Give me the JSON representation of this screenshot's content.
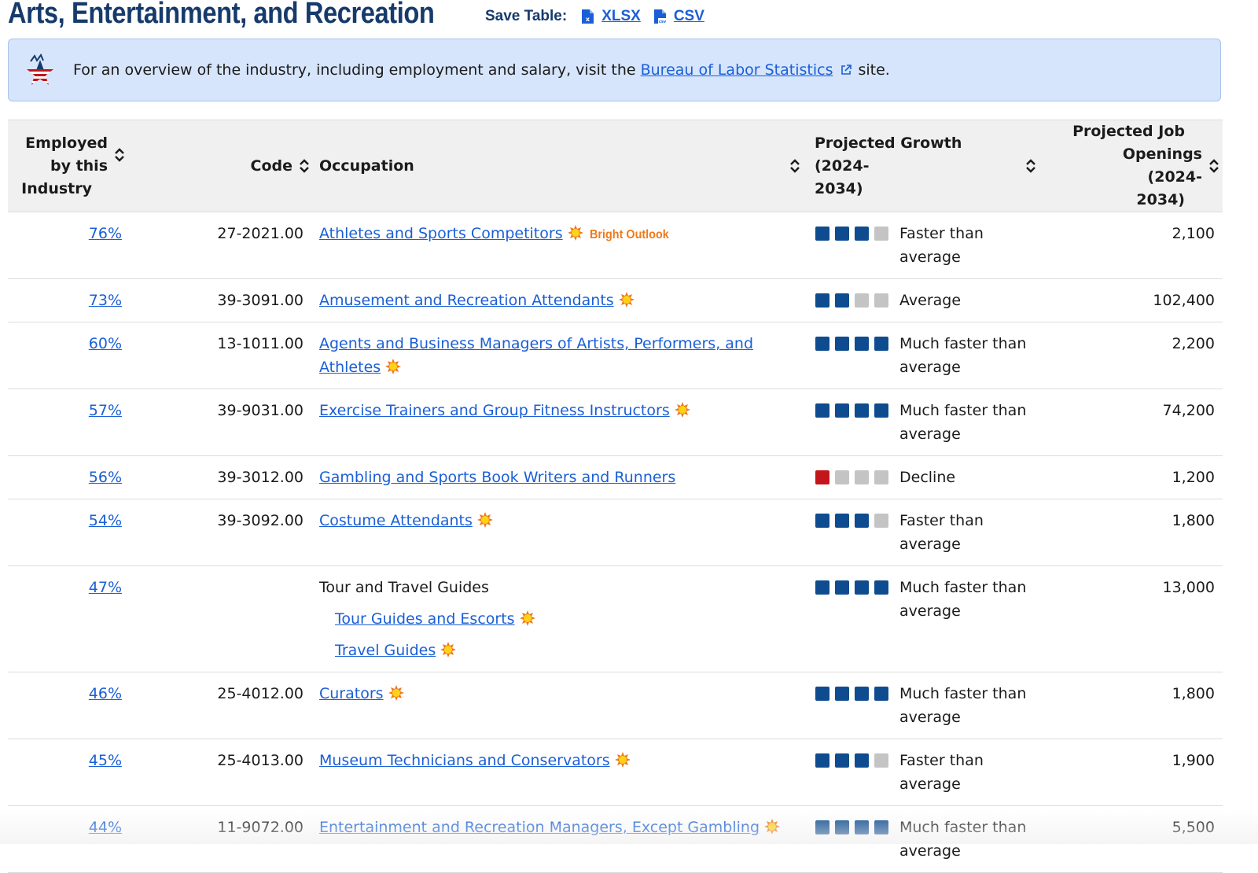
{
  "header": {
    "title": "Arts, Entertainment, and Recreation",
    "save_label": "Save Table:",
    "xlsx_label": "XLSX",
    "csv_label": "CSV"
  },
  "banner": {
    "text_before": "For an overview of the industry, including employment and salary, visit the",
    "link_text": "Bureau of Labor Statistics",
    "text_after": "site."
  },
  "table": {
    "columns": {
      "employed": [
        "Employed",
        "by this",
        "Industry"
      ],
      "code": "Code",
      "occupation": "Occupation",
      "growth": [
        "Projected Growth (2024-",
        "2034)"
      ],
      "openings": [
        "Projected Job",
        "Openings (2024-",
        "2034)"
      ]
    },
    "bright_outlook_label": "Bright Outlook",
    "rows": [
      {
        "pct": "76%",
        "code": "27-2021.00",
        "occupation": "Athletes and Sports Competitors",
        "growth_level": 3,
        "growth": "Faster than average",
        "openings": "2,100"
      },
      {
        "pct": "73%",
        "code": "39-3091.00",
        "occupation": "Amusement and Recreation Attendants",
        "growth_level": 2,
        "growth": "Average",
        "openings": "102,400"
      },
      {
        "pct": "60%",
        "code": "13-1011.00",
        "occupation": "Agents and Business Managers of Artists, Performers, and Athletes",
        "growth_level": 4,
        "growth": "Much faster than average",
        "openings": "2,200"
      },
      {
        "pct": "57%",
        "code": "39-9031.00",
        "occupation": "Exercise Trainers and Group Fitness Instructors",
        "growth_level": 4,
        "growth": "Much faster than average",
        "openings": "74,200"
      },
      {
        "pct": "56%",
        "code": "39-3012.00",
        "occupation": "Gambling and Sports Book Writers and Runners",
        "growth_level": 0,
        "growth": "Decline",
        "openings": "1,200"
      },
      {
        "pct": "54%",
        "code": "39-3092.00",
        "occupation": "Costume Attendants",
        "growth_level": 3,
        "growth": "Faster than average",
        "openings": "1,800"
      },
      {
        "pct": "47%",
        "code": "",
        "occupation": "Tour and Travel Guides",
        "sub": [
          "Tour Guides and Escorts",
          "Travel Guides"
        ],
        "growth_level": 4,
        "growth": "Much faster than average",
        "openings": "13,000"
      },
      {
        "pct": "46%",
        "code": "25-4012.00",
        "occupation": "Curators",
        "growth_level": 4,
        "growth": "Much faster than average",
        "openings": "1,800"
      },
      {
        "pct": "45%",
        "code": "25-4013.00",
        "occupation": "Museum Technicians and Conservators",
        "growth_level": 3,
        "growth": "Faster than average",
        "openings": "1,900"
      },
      {
        "pct": "44%",
        "code": "11-9072.00",
        "occupation": "Entertainment and Recreation Managers, Except Gambling",
        "growth_level": 4,
        "growth": "Much faster than average",
        "openings": "5,500"
      }
    ]
  },
  "colors": {
    "title": "#163a6b",
    "link": "#1a5fd6",
    "banner_bg": "#d6e5fc",
    "growth_on": "#0f4c8f",
    "growth_off": "#c4c4c4",
    "decline": "#c2161b",
    "bright_outlook": "#f07a1a"
  }
}
